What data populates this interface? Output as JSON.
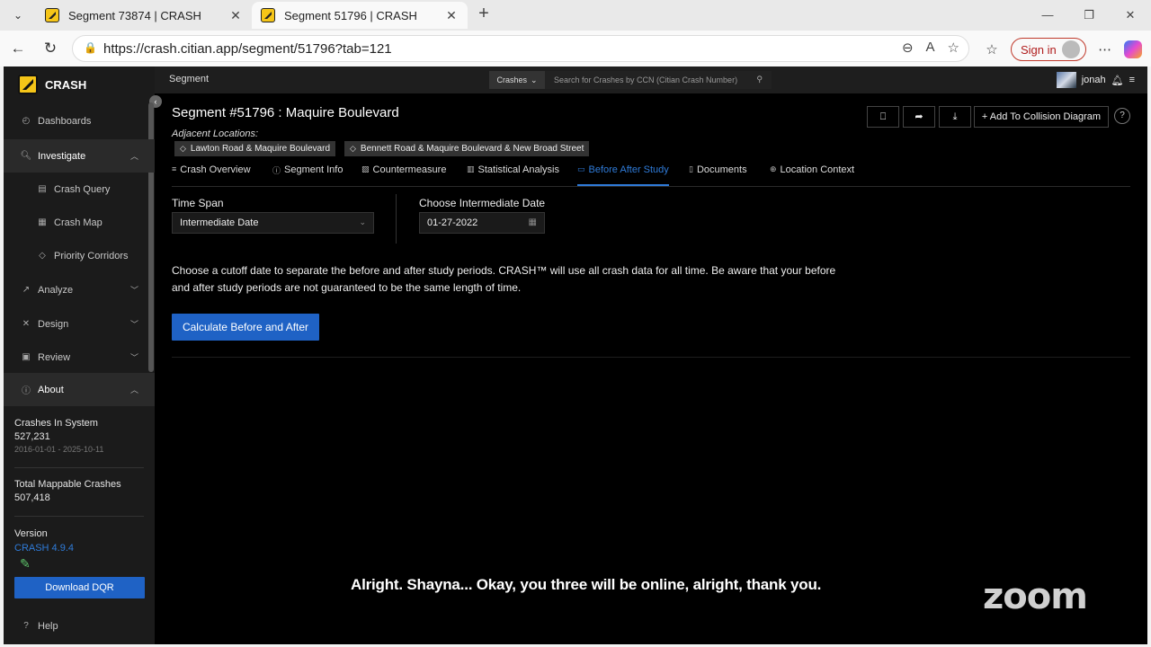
{
  "browser": {
    "tabs": [
      {
        "title": "Segment 73874 | CRASH",
        "active": false
      },
      {
        "title": "Segment 51796 | CRASH",
        "active": true
      }
    ],
    "url": "https://crash.citian.app/segment/51796?tab=121",
    "sign_in": "Sign in"
  },
  "app": {
    "brand": "CRASH",
    "sidebar": {
      "items": [
        {
          "label": "Dashboards"
        },
        {
          "label": "Investigate"
        },
        {
          "label": "Crash Query"
        },
        {
          "label": "Crash Map"
        },
        {
          "label": "Priority Corridors"
        },
        {
          "label": "Analyze"
        },
        {
          "label": "Design"
        },
        {
          "label": "Review"
        },
        {
          "label": "About"
        }
      ],
      "about": {
        "crashes_label": "Crashes In System",
        "crashes_value": "527,231",
        "crashes_range": "2016-01-01 - 2025-10-11",
        "mappable_label": "Total Mappable Crashes",
        "mappable_value": "507,418",
        "version_label": "Version",
        "version_value": "CRASH 4.9.4"
      },
      "download_dqr": "Download DQR",
      "help": "Help"
    },
    "topbar": {
      "crumb": "Segment",
      "search_select": "Crashes",
      "search_placeholder": "Search for Crashes by CCN (Citian Crash Number)",
      "user": "jonah"
    },
    "page": {
      "title": "Segment #51796 : Maquire Boulevard",
      "adjacent_label": "Adjacent Locations:",
      "adjacent": [
        "Lawton Road & Maquire Boulevard",
        "Bennett Road & Maquire Boulevard & New Broad Street"
      ],
      "add_collision": "+ Add To Collision Diagram",
      "tabs": [
        {
          "label": "Crash Overview",
          "icon": "list-icon"
        },
        {
          "label": "Segment Info",
          "icon": "info-icon"
        },
        {
          "label": "Countermeasure",
          "icon": "image-icon"
        },
        {
          "label": "Statistical Analysis",
          "icon": "bar-chart-icon"
        },
        {
          "label": "Before After Study",
          "icon": "calendar-icon",
          "active": true
        },
        {
          "label": "Documents",
          "icon": "document-icon"
        },
        {
          "label": "Location Context",
          "icon": "zoom-location-icon"
        }
      ],
      "time_span_label": "Time Span",
      "time_span_value": "Intermediate Date",
      "intermediate_label": "Choose Intermediate Date",
      "intermediate_value": "01-27-2022",
      "description": "Choose a cutoff date to separate the before and after study periods. CRASH™ will use all crash data for all time. Be aware that your before and after study periods are not guaranteed to be the same length of time.",
      "calculate_button": "Calculate Before and After"
    }
  },
  "overlay": {
    "caption": "Alright. Shayna... Okay, you three will be online, alright, thank you.",
    "zoom_logo": "zoom"
  }
}
